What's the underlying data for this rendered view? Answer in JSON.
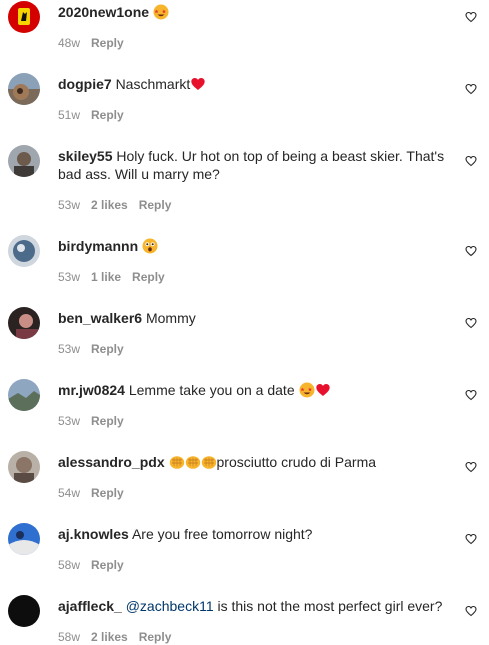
{
  "comments": [
    {
      "username": "2020new1one",
      "text": "",
      "time": "48w",
      "likes": "",
      "reply": "Reply",
      "emoji": [
        "star-struck"
      ]
    },
    {
      "username": "dogpie7",
      "text": "Naschmarkt",
      "time": "51w",
      "likes": "",
      "reply": "Reply",
      "emoji": [
        "red-heart"
      ]
    },
    {
      "username": "skiley55",
      "text": "Holy fuck. Ur hot on top of being a beast skier. That's bad ass. Will u marry me?",
      "time": "53w",
      "likes": "2 likes",
      "reply": "Reply",
      "emoji": []
    },
    {
      "username": "birdymannn",
      "text": "",
      "time": "53w",
      "likes": "1 like",
      "reply": "Reply",
      "emoji": [
        "astonished-face"
      ]
    },
    {
      "username": "ben_walker6",
      "text": "Mommy",
      "time": "53w",
      "likes": "",
      "reply": "Reply",
      "emoji": []
    },
    {
      "username": "mr.jw0824",
      "text": "Lemme take you on a date",
      "time": "53w",
      "likes": "",
      "reply": "Reply",
      "emoji": [
        "star-struck",
        "red-heart"
      ]
    },
    {
      "username": "alessandro_pdx",
      "text": "prosciutto crudo di Parma",
      "time": "54w",
      "likes": "",
      "reply": "Reply",
      "emoji": [
        "oncoming-fist",
        "oncoming-fist",
        "oncoming-fist"
      ]
    },
    {
      "username": "aj.knowles",
      "text": "Are you free tomorrow night?",
      "time": "58w",
      "likes": "",
      "reply": "Reply",
      "emoji": []
    },
    {
      "username": "ajaffleck_",
      "mention": "@zachbeck11",
      "text": "is this not the most perfect girl ever?",
      "time": "58w",
      "likes": "2 likes",
      "reply": "Reply",
      "emoji": []
    }
  ],
  "icons": {
    "like": "heart-outline-icon"
  },
  "colors": {
    "text": "#262626",
    "meta": "#8e8e8e",
    "mention": "#00376b",
    "heart": "#e8112d"
  }
}
